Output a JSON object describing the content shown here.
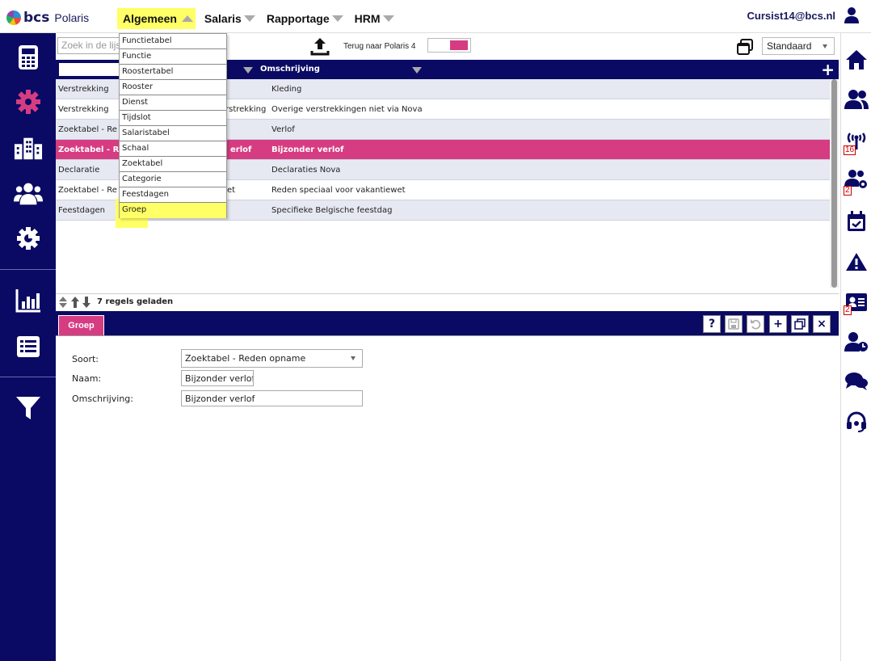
{
  "app": {
    "brand": "bcs",
    "product": "Polaris"
  },
  "menu": [
    {
      "label": "Algemeen",
      "active": true
    },
    {
      "label": "Salaris",
      "active": false
    },
    {
      "label": "Rapportage",
      "active": false
    },
    {
      "label": "HRM",
      "active": false
    }
  ],
  "dropdown": {
    "items": [
      "Functietabel",
      "Functie",
      "Roostertabel",
      "Rooster",
      "Dienst",
      "Tijdslot",
      "Salaristabel",
      "Schaal",
      "Zoektabel",
      "Categorie",
      "Feestdagen",
      "Groep"
    ],
    "highlighted": "Groep"
  },
  "user": {
    "name": "Cursist14@bcs.nl"
  },
  "toolbar": {
    "search_placeholder": "Zoek in de lijst",
    "back_label": "Terug naar Polaris 4",
    "view_selected": "Standaard"
  },
  "grid": {
    "column_header": "Omschrijving",
    "rows": [
      {
        "c1": "Verstrekking",
        "c2": "",
        "c3": "Kleding",
        "state": "alt"
      },
      {
        "c1": "Verstrekking",
        "c2": "rstrekking",
        "c3": "Overige verstrekkingen niet via Nova",
        "state": ""
      },
      {
        "c1": "Zoektabel - Re",
        "c2": "",
        "c3": "Verlof",
        "state": "alt"
      },
      {
        "c1": "Zoektabel - Re",
        "c2": "erlof",
        "c3": "Bijzonder verlof",
        "state": "sel"
      },
      {
        "c1": "Declaratie",
        "c2": "",
        "c3": "Declaraties Nova",
        "state": "alt"
      },
      {
        "c1": "Zoektabel - Re",
        "c2": "et",
        "c3": "Reden speciaal voor vakantiewet",
        "state": ""
      },
      {
        "c1": "Feestdagen",
        "c2": "",
        "c3": "Specifieke Belgische feestdag",
        "state": "alt"
      }
    ],
    "status": "7 regels geladen"
  },
  "detail": {
    "tab_label": "Groep",
    "fields": {
      "soort_label": "Soort:",
      "soort_value": "Zoektabel - Reden opname",
      "naam_label": "Naam:",
      "naam_value": "Bijzonder verlof",
      "omschrijving_label": "Omschrijving:",
      "omschrijving_value": "Bijzonder verlof"
    },
    "buttons": [
      "?",
      "save",
      "undo",
      "+",
      "copy",
      "×"
    ]
  },
  "right_badges": {
    "signal": "16",
    "users_settings": "2",
    "contact_card": "2"
  },
  "colors": {
    "navy": "#0a0a64",
    "accent": "#d63c82",
    "highlight": "#ffff66"
  }
}
